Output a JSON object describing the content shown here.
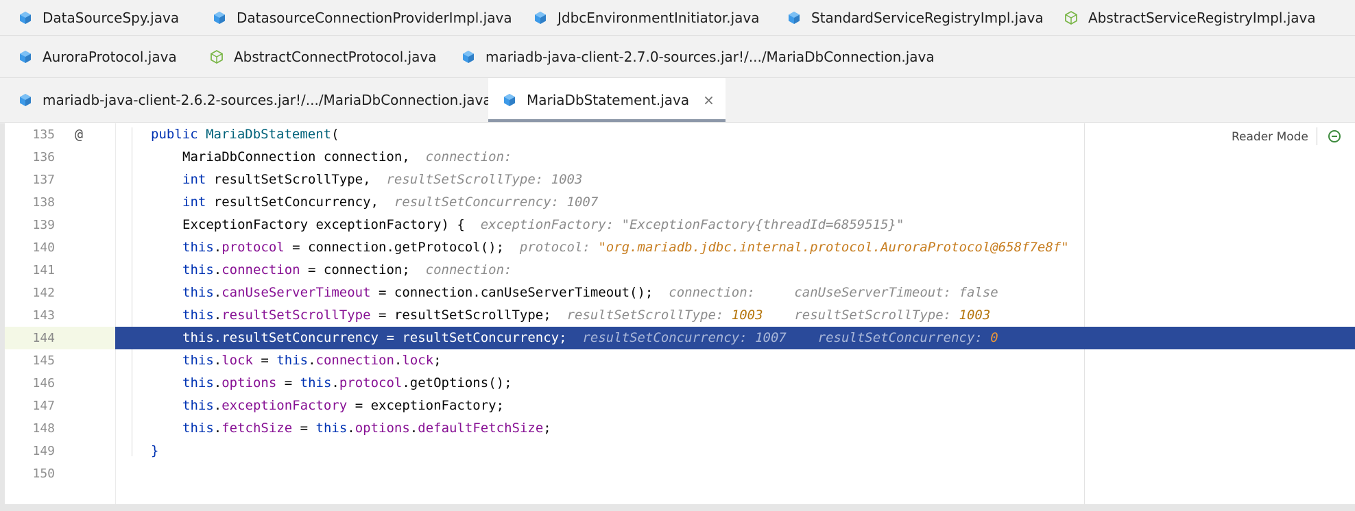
{
  "tabs": {
    "row1": [
      {
        "label": "DataSourceSpy.java",
        "icon": "java-class-icon"
      },
      {
        "label": "DatasourceConnectionProviderImpl.java",
        "icon": "java-class-icon"
      },
      {
        "label": "JdbcEnvironmentInitiator.java",
        "icon": "java-class-icon"
      },
      {
        "label": "StandardServiceRegistryImpl.java",
        "icon": "java-class-icon"
      },
      {
        "label": "AbstractServiceRegistryImpl.java",
        "icon": "java-abstract-class-icon"
      }
    ],
    "row2": [
      {
        "label": "AuroraProtocol.java",
        "icon": "java-class-icon"
      },
      {
        "label": "AbstractConnectProtocol.java",
        "icon": "java-abstract-class-icon"
      },
      {
        "label": "mariadb-java-client-2.7.0-sources.jar!/.../MariaDbConnection.java",
        "icon": "java-class-icon"
      }
    ],
    "row3": [
      {
        "label": "mariadb-java-client-2.6.2-sources.jar!/.../MariaDbConnection.java",
        "icon": "java-class-icon"
      },
      {
        "label": "MariaDbStatement.java",
        "icon": "java-class-icon",
        "active": true,
        "close": "×"
      }
    ]
  },
  "editor": {
    "reader_mode": "Reader Mode",
    "highlight_line": "144",
    "lines": [
      {
        "n": "135",
        "g": "@"
      },
      {
        "n": "136"
      },
      {
        "n": "137"
      },
      {
        "n": "138"
      },
      {
        "n": "139"
      },
      {
        "n": "140"
      },
      {
        "n": "141"
      },
      {
        "n": "142"
      },
      {
        "n": "143"
      },
      {
        "n": "144"
      },
      {
        "n": "145"
      },
      {
        "n": "146"
      },
      {
        "n": "147"
      },
      {
        "n": "148"
      },
      {
        "n": "149"
      },
      {
        "n": "150"
      }
    ],
    "code": {
      "l135": {
        "a": "public ",
        "b": "MariaDbStatement",
        "c": "("
      },
      "l136": {
        "a": "MariaDbConnection connection,",
        "h": "connection:"
      },
      "l137": {
        "kw": "int",
        "a": " resultSetScrollType,",
        "h": "resultSetScrollType: 1003"
      },
      "l138": {
        "kw": "int",
        "a": " resultSetConcurrency,",
        "h": "resultSetConcurrency: 1007"
      },
      "l139": {
        "a": "ExceptionFactory exceptionFactory) {",
        "h": "exceptionFactory: ",
        "s": "\"ExceptionFactory{threadId=6859515}\""
      },
      "l140": {
        "t": "this",
        "d": ".",
        "f": "protocol",
        "a": " = connection.getProtocol();",
        "h": "protocol: ",
        "s": "\"org.mariadb.jdbc.internal.protocol.AuroraProtocol@658f7e8f\""
      },
      "l141": {
        "t": "this",
        "d": ".",
        "f": "connection",
        "a": " = connection;",
        "h": "connection:"
      },
      "l142": {
        "t": "this",
        "d": ".",
        "f": "canUseServerTimeout",
        "a": " = connection.canUseServerTimeout();",
        "h": "connection:",
        "h2": "canUseServerTimeout: false"
      },
      "l143": {
        "t": "this",
        "d": ".",
        "f": "resultSetScrollType",
        "a": " = resultSetScrollType;",
        "h": "resultSetScrollType: ",
        "hn": "1003",
        "h2": "resultSetScrollType: ",
        "h2n": "1003"
      },
      "l144": {
        "t": "this",
        "d": ".",
        "f": "resultSetConcurrency",
        "a": " = resultSetConcurrency;",
        "h": "resultSetConcurrency: 1007",
        "h2": "resultSetConcurrency: ",
        "h2n": "0"
      },
      "l145": {
        "t": "this",
        "d": ".",
        "f": "lock",
        "a": " = ",
        "t2": "this",
        "d2": ".",
        "f2": "connection",
        "d3": ".",
        "f3": "lock",
        "e": ";"
      },
      "l146": {
        "t": "this",
        "d": ".",
        "f": "options",
        "a": " = ",
        "t2": "this",
        "d2": ".",
        "f2": "protocol",
        "e": ".getOptions();"
      },
      "l147": {
        "t": "this",
        "d": ".",
        "f": "exceptionFactory",
        "a": " = exceptionFactory;"
      },
      "l148": {
        "t": "this",
        "d": ".",
        "f": "fetchSize",
        "a": " = ",
        "t2": "this",
        "d2": ".",
        "f2": "options",
        "d3": ".",
        "f3": "defaultFetchSize",
        "e": ";"
      },
      "l149": {
        "a": "}"
      }
    }
  },
  "colors": {
    "accent": "#2a4a9a",
    "keyword": "#0033b3",
    "field": "#871094",
    "hint": "#8c8c8c"
  }
}
